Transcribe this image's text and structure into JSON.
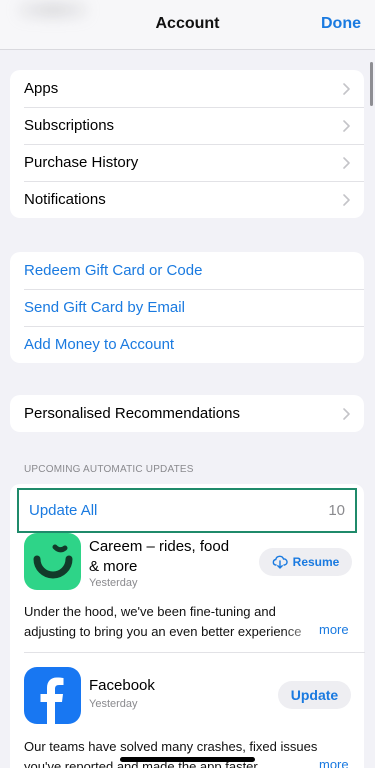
{
  "header": {
    "title": "Account",
    "done_label": "Done"
  },
  "group_primary": {
    "items": [
      {
        "label": "Apps"
      },
      {
        "label": "Subscriptions"
      },
      {
        "label": "Purchase History"
      },
      {
        "label": "Notifications"
      }
    ]
  },
  "group_money": {
    "items": [
      {
        "label": "Redeem Gift Card or Code"
      },
      {
        "label": "Send Gift Card by Email"
      },
      {
        "label": "Add Money to Account"
      }
    ]
  },
  "group_recommend": {
    "label": "Personalised Recommendations"
  },
  "updates": {
    "section_label": "UPCOMING AUTOMATIC UPDATES",
    "update_all_label": "Update All",
    "count": "10",
    "apps": [
      {
        "name_line1": "Careem – rides, food",
        "name_line2": "& more",
        "date": "Yesterday",
        "action": "Resume",
        "desc_line1": "Under the hood, we've been fine-tuning and",
        "desc_line2": "adjusting to bring you an even better experience",
        "more": "more",
        "icon": "careem-smile-icon"
      },
      {
        "name_line1": "Facebook",
        "date": "Yesterday",
        "action": "Update",
        "desc_line1": "Our teams have solved many crashes, fixed issues",
        "desc_line2": "you've reported and made the app faster.",
        "more": "more",
        "icon": "facebook-f-icon"
      }
    ]
  },
  "colors": {
    "accent": "#1a7ae0",
    "highlight_border": "#1f8a6a",
    "careem": "#2ed488",
    "facebook": "#1877f2"
  }
}
